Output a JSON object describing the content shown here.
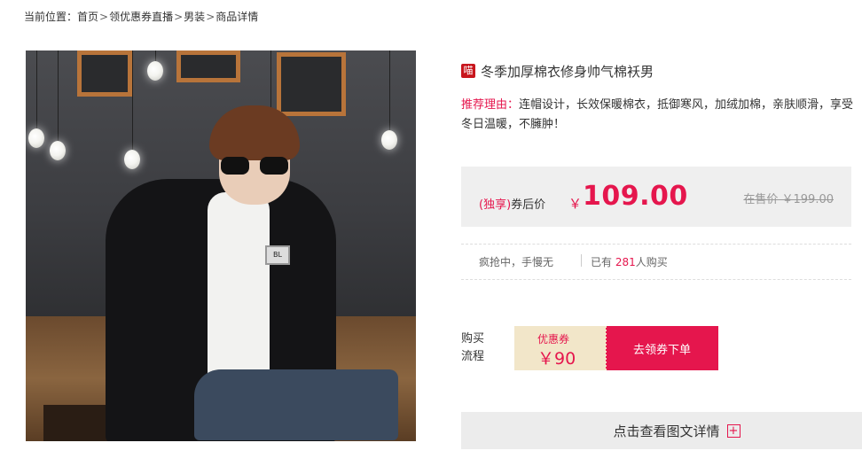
{
  "breadcrumb": {
    "prefix": "当前位置：",
    "items": [
      "首页",
      "领优惠券直播",
      "男装",
      "商品详情"
    ],
    "separator": ">"
  },
  "product": {
    "badge": "喵",
    "title": "冬季加厚棉衣修身帅气棉袄男",
    "reason_label": "推荐理由：",
    "reason_text": "连帽设计，长效保暖棉衣，抵御寒风，加绒加棉，亲肤顺滑，享受冬日温暖，不臃肿！",
    "photo_badge_text": "BL"
  },
  "price": {
    "exclusive": "(独享)",
    "label": "券后价",
    "currency": "￥",
    "value": "109.00",
    "original": "在售价 ￥199.00"
  },
  "stats": {
    "rush": "疯抢中，手慢无",
    "bought_prefix": "已有",
    "bought_count": "281",
    "bought_suffix": "人购买"
  },
  "purchase": {
    "flow_label": "购买流程",
    "coupon_label": "优惠券",
    "coupon_value": "￥90",
    "button_label": "去领券下单"
  },
  "detail": {
    "label": "点击查看图文详情",
    "icon": "plus-icon"
  },
  "colors": {
    "accent": "#e5164d",
    "badge_red": "#c8161d",
    "coupon_bg": "#f2e6c9",
    "price_box_bg": "#efefef"
  }
}
